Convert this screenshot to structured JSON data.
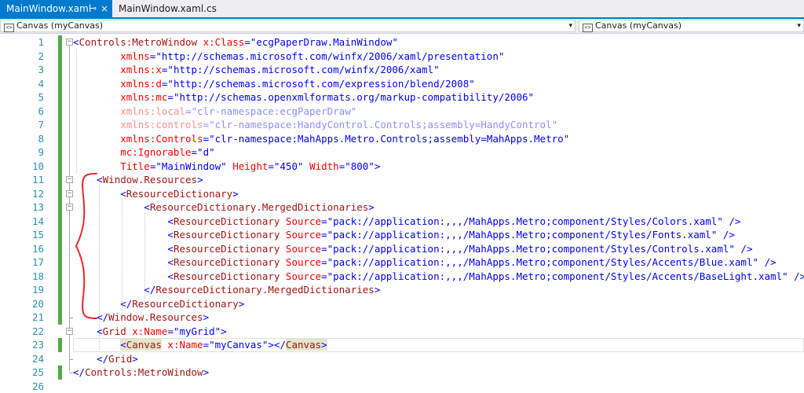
{
  "tabs": {
    "active_label": "MainWindow.xaml",
    "pin_icon": "⊸",
    "close_icon": "×",
    "inactive_label": "MainWindow.xaml.cs"
  },
  "navbar": {
    "left_value": "Canvas (myCanvas)",
    "right_value": "Canvas (myCanvas)",
    "icon_glyph": "<>",
    "arrow": "▾"
  },
  "editor": {
    "line_numbers": [
      "1",
      "2",
      "3",
      "4",
      "5",
      "6",
      "7",
      "8",
      "9",
      "10",
      "11",
      "12",
      "13",
      "14",
      "15",
      "16",
      "17",
      "18",
      "19",
      "20",
      "21",
      "22",
      "23",
      "24",
      "25",
      "26"
    ],
    "lines": [
      [
        {
          "t": "<",
          "c": "br"
        },
        {
          "t": "Controls:MetroWindow",
          "c": "tag"
        },
        {
          "t": " x:Class",
          "c": "attr"
        },
        {
          "t": "=",
          "c": "br"
        },
        {
          "t": "\"ecgPaperDraw.MainWindow\"",
          "c": "val"
        }
      ],
      [
        {
          "t": "        xmlns",
          "c": "attr"
        },
        {
          "t": "=",
          "c": "br"
        },
        {
          "t": "\"http://schemas.microsoft.com/winfx/2006/xaml/presentation\"",
          "c": "val"
        }
      ],
      [
        {
          "t": "        xmlns:x",
          "c": "attr"
        },
        {
          "t": "=",
          "c": "br"
        },
        {
          "t": "\"http://schemas.microsoft.com/winfx/2006/xaml\"",
          "c": "val"
        }
      ],
      [
        {
          "t": "        xmlns:d",
          "c": "attr"
        },
        {
          "t": "=",
          "c": "br"
        },
        {
          "t": "\"http://schemas.microsoft.com/expression/blend/2008\"",
          "c": "val"
        }
      ],
      [
        {
          "t": "        xmlns:mc",
          "c": "attr"
        },
        {
          "t": "=",
          "c": "br"
        },
        {
          "t": "\"http://schemas.openxmlformats.org/markup-compatibility/2006\"",
          "c": "val"
        }
      ],
      [
        {
          "t": "        xmlns:local",
          "c": "attr dim"
        },
        {
          "t": "=",
          "c": "br dim"
        },
        {
          "t": "\"clr-namespace:ecgPaperDraw\"",
          "c": "val dim"
        }
      ],
      [
        {
          "t": "        xmlns:controls",
          "c": "attr dim"
        },
        {
          "t": "=",
          "c": "br dim"
        },
        {
          "t": "\"clr-namespace:HandyControl.Controls;assembly=HandyControl\"",
          "c": "val dim"
        }
      ],
      [
        {
          "t": "        xmlns:Controls",
          "c": "attr"
        },
        {
          "t": "=",
          "c": "br"
        },
        {
          "t": "\"clr-namespace:MahApps.Metro.Controls;assembly=MahApps.Metro\"",
          "c": "val"
        }
      ],
      [
        {
          "t": "        mc:Ignorable",
          "c": "attr"
        },
        {
          "t": "=",
          "c": "br"
        },
        {
          "t": "\"d\"",
          "c": "val"
        }
      ],
      [
        {
          "t": "        Title",
          "c": "attr"
        },
        {
          "t": "=",
          "c": "br"
        },
        {
          "t": "\"MainWindow\"",
          "c": "val"
        },
        {
          "t": " Height",
          "c": "attr"
        },
        {
          "t": "=",
          "c": "br"
        },
        {
          "t": "\"450\"",
          "c": "val"
        },
        {
          "t": " Width",
          "c": "attr"
        },
        {
          "t": "=",
          "c": "br"
        },
        {
          "t": "\"800\"",
          "c": "val"
        },
        {
          "t": ">",
          "c": "br"
        }
      ],
      [
        {
          "t": "    <",
          "c": "br"
        },
        {
          "t": "Window.Resources",
          "c": "tag"
        },
        {
          "t": ">",
          "c": "br"
        }
      ],
      [
        {
          "t": "        <",
          "c": "br"
        },
        {
          "t": "ResourceDictionary",
          "c": "tag"
        },
        {
          "t": ">",
          "c": "br"
        }
      ],
      [
        {
          "t": "            <",
          "c": "br"
        },
        {
          "t": "ResourceDictionary.MergedDictionaries",
          "c": "tag"
        },
        {
          "t": ">",
          "c": "br"
        }
      ],
      [
        {
          "t": "                <",
          "c": "br"
        },
        {
          "t": "ResourceDictionary",
          "c": "tag"
        },
        {
          "t": " Source",
          "c": "attr"
        },
        {
          "t": "=",
          "c": "br"
        },
        {
          "t": "\"pack://application:,,,/MahApps.Metro;component/Styles/Colors.xaml\"",
          "c": "val"
        },
        {
          "t": " />",
          "c": "br"
        }
      ],
      [
        {
          "t": "                <",
          "c": "br"
        },
        {
          "t": "ResourceDictionary",
          "c": "tag"
        },
        {
          "t": " Source",
          "c": "attr"
        },
        {
          "t": "=",
          "c": "br"
        },
        {
          "t": "\"pack://application:,,,/MahApps.Metro;component/Styles/Fonts.xaml\"",
          "c": "val"
        },
        {
          "t": " />",
          "c": "br"
        }
      ],
      [
        {
          "t": "                <",
          "c": "br"
        },
        {
          "t": "ResourceDictionary",
          "c": "tag"
        },
        {
          "t": " Source",
          "c": "attr"
        },
        {
          "t": "=",
          "c": "br"
        },
        {
          "t": "\"pack://application:,,,/MahApps.Metro;component/Styles/Controls.xaml\"",
          "c": "val"
        },
        {
          "t": " />",
          "c": "br"
        }
      ],
      [
        {
          "t": "                <",
          "c": "br"
        },
        {
          "t": "ResourceDictionary",
          "c": "tag"
        },
        {
          "t": " Source",
          "c": "attr"
        },
        {
          "t": "=",
          "c": "br"
        },
        {
          "t": "\"pack://application:,,,/MahApps.Metro;component/Styles/Accents/Blue.xaml\"",
          "c": "val"
        },
        {
          "t": " />",
          "c": "br"
        }
      ],
      [
        {
          "t": "                <",
          "c": "br"
        },
        {
          "t": "ResourceDictionary",
          "c": "tag"
        },
        {
          "t": " Source",
          "c": "attr"
        },
        {
          "t": "=",
          "c": "br"
        },
        {
          "t": "\"pack://application:,,,/MahApps.Metro;component/Styles/Accents/BaseLight.xaml\"",
          "c": "val"
        },
        {
          "t": " />",
          "c": "br"
        }
      ],
      [
        {
          "t": "            </",
          "c": "br"
        },
        {
          "t": "ResourceDictionary.MergedDictionaries",
          "c": "tag"
        },
        {
          "t": ">",
          "c": "br"
        }
      ],
      [
        {
          "t": "        </",
          "c": "br"
        },
        {
          "t": "ResourceDictionary",
          "c": "tag"
        },
        {
          "t": ">",
          "c": "br"
        }
      ],
      [
        {
          "t": "    </",
          "c": "br"
        },
        {
          "t": "Window.Resources",
          "c": "tag"
        },
        {
          "t": ">",
          "c": "br"
        }
      ],
      [
        {
          "t": "    <",
          "c": "br"
        },
        {
          "t": "Grid",
          "c": "tag"
        },
        {
          "t": " x:Name",
          "c": "attr"
        },
        {
          "t": "=",
          "c": "br"
        },
        {
          "t": "\"myGrid\"",
          "c": "val"
        },
        {
          "t": ">",
          "c": "br"
        }
      ],
      [
        {
          "t": "        ",
          "c": ""
        },
        {
          "t": "<",
          "c": "br hl"
        },
        {
          "t": "Canvas",
          "c": "tag hl"
        },
        {
          "t": " x:Name",
          "c": "attr"
        },
        {
          "t": "=",
          "c": "br"
        },
        {
          "t": "\"myCanvas\"",
          "c": "val"
        },
        {
          "t": "></",
          "c": "br"
        },
        {
          "t": "Canvas",
          "c": "tag hl"
        },
        {
          "t": ">",
          "c": "br hl"
        }
      ],
      [
        {
          "t": "    </",
          "c": "br"
        },
        {
          "t": "Grid",
          "c": "tag"
        },
        {
          "t": ">",
          "c": "br"
        }
      ],
      [
        {
          "t": "</",
          "c": "br"
        },
        {
          "t": "Controls:MetroWindow",
          "c": "tag"
        },
        {
          "t": ">",
          "c": "br"
        }
      ],
      []
    ],
    "changed_lines": [
      1,
      2,
      3,
      4,
      5,
      6,
      7,
      8,
      9,
      10,
      11,
      12,
      13,
      14,
      15,
      16,
      17,
      18,
      19,
      20,
      21,
      23,
      25
    ],
    "fold_markers": {
      "1": "−",
      "11": "−",
      "12": "−",
      "13": "−",
      "22": "−"
    },
    "current_line": 23
  },
  "annotation_color": "#e8282e"
}
